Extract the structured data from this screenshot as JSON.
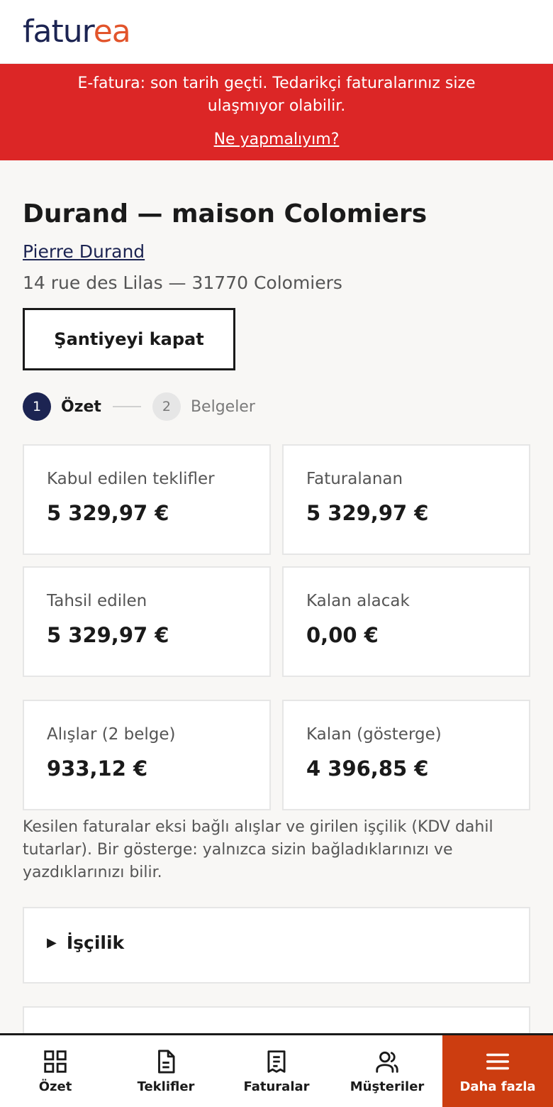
{
  "brand": {
    "logo_part1": "fatur",
    "logo_part2": "ea",
    "accent": "#e2542b",
    "navy": "#1c2452"
  },
  "banner": {
    "message": "E-fatura: son tarih geçti. Tedarikçi faturalarınız size ulaşmıyor olabilir.",
    "link": "Ne yapmalıyım?",
    "color": "#dc2626"
  },
  "project": {
    "title": "Durand — maison Colomiers",
    "client": "Pierre Durand",
    "address": "14 rue des Lilas — 31770 Colomiers",
    "close_button": "Şantiyeyi kapat"
  },
  "stepper": {
    "steps": [
      {
        "num": "1",
        "label": "Özet"
      },
      {
        "num": "2",
        "label": "Belgeler"
      }
    ]
  },
  "cards": [
    {
      "label": "Kabul edilen teklifler",
      "value": "5 329,97 €"
    },
    {
      "label": "Faturalanan",
      "value": "5 329,97 €"
    },
    {
      "label": "Tahsil edilen",
      "value": "5 329,97 €"
    },
    {
      "label": "Kalan alacak",
      "value": "0,00 €"
    },
    {
      "label": "Alışlar (2 belge)",
      "value": "933,12 €"
    },
    {
      "label": "Kalan (gösterge)",
      "value": "4 396,85 €"
    }
  ],
  "note": "Kesilen faturalar eksi bağlı alışlar ve girilen işçilik (KDV dahil tutarlar). Bir gösterge: yalnızca sizin bağladıklarınızı ve yazdıklarınızı bilir.",
  "sections": [
    {
      "label": "İşçilik"
    }
  ],
  "nav": {
    "items": [
      {
        "label": "Özet",
        "icon": "grid-icon"
      },
      {
        "label": "Teklifler",
        "icon": "document-icon"
      },
      {
        "label": "Faturalar",
        "icon": "receipt-icon"
      },
      {
        "label": "Müşteriler",
        "icon": "users-icon"
      },
      {
        "label": "Daha fazla",
        "icon": "menu-icon"
      }
    ],
    "active_color": "#cc3d10"
  }
}
